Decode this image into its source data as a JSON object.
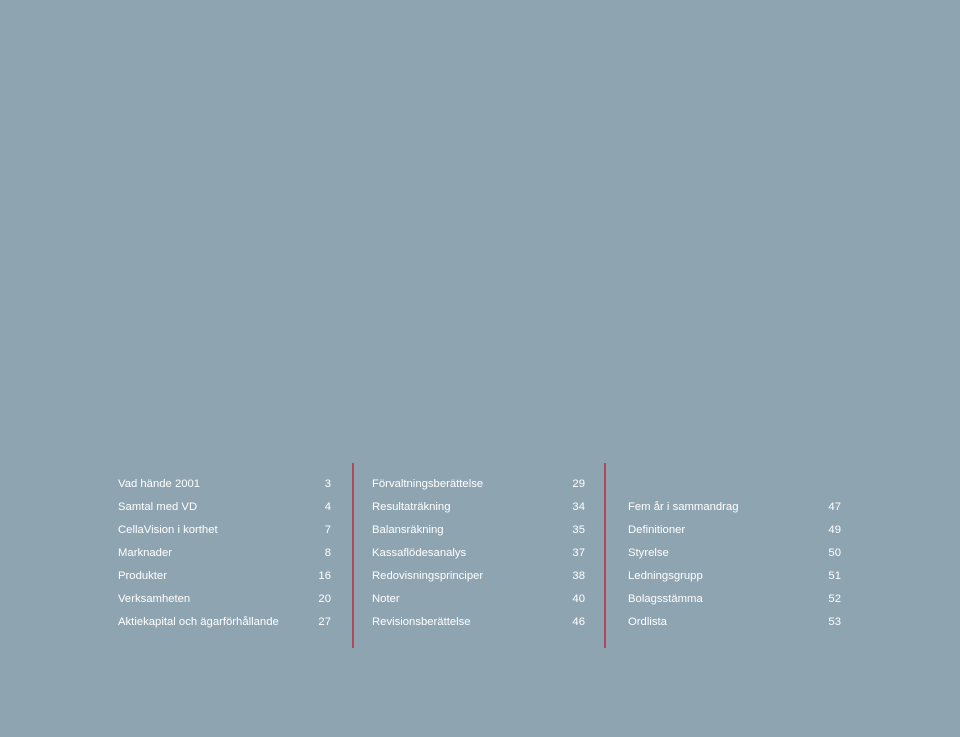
{
  "toc": {
    "column1": [
      {
        "title": "Vad hände 2001",
        "page": "3"
      },
      {
        "title": "Samtal med VD",
        "page": "4"
      },
      {
        "title": "CellaVision i korthet",
        "page": "7"
      },
      {
        "title": "Marknader",
        "page": "8"
      },
      {
        "title": "Produkter",
        "page": "16"
      },
      {
        "title": "Verksamheten",
        "page": "20"
      },
      {
        "title": "Aktiekapital och ägarförhållande",
        "page": "27"
      }
    ],
    "column2": [
      {
        "title": "Förvaltningsberättelse",
        "page": "29"
      },
      {
        "title": "Resultaträkning",
        "page": "34"
      },
      {
        "title": "Balansräkning",
        "page": "35"
      },
      {
        "title": "Kassaflödesanalys",
        "page": "37"
      },
      {
        "title": "Redovisningsprinciper",
        "page": "38"
      },
      {
        "title": "Noter",
        "page": "40"
      },
      {
        "title": "Revisionsberättelse",
        "page": "46"
      }
    ],
    "column3": [
      {
        "title": "Fem år i sammandrag",
        "page": "47"
      },
      {
        "title": "Definitioner",
        "page": "49"
      },
      {
        "title": "Styrelse",
        "page": "50"
      },
      {
        "title": "Ledningsgrupp",
        "page": "51"
      },
      {
        "title": "Bolagsstämma",
        "page": "52"
      },
      {
        "title": "Ordlista",
        "page": "53"
      }
    ]
  },
  "colors": {
    "background": "#8ea4b1",
    "text": "#ffffff",
    "divider": "#b0495a"
  }
}
